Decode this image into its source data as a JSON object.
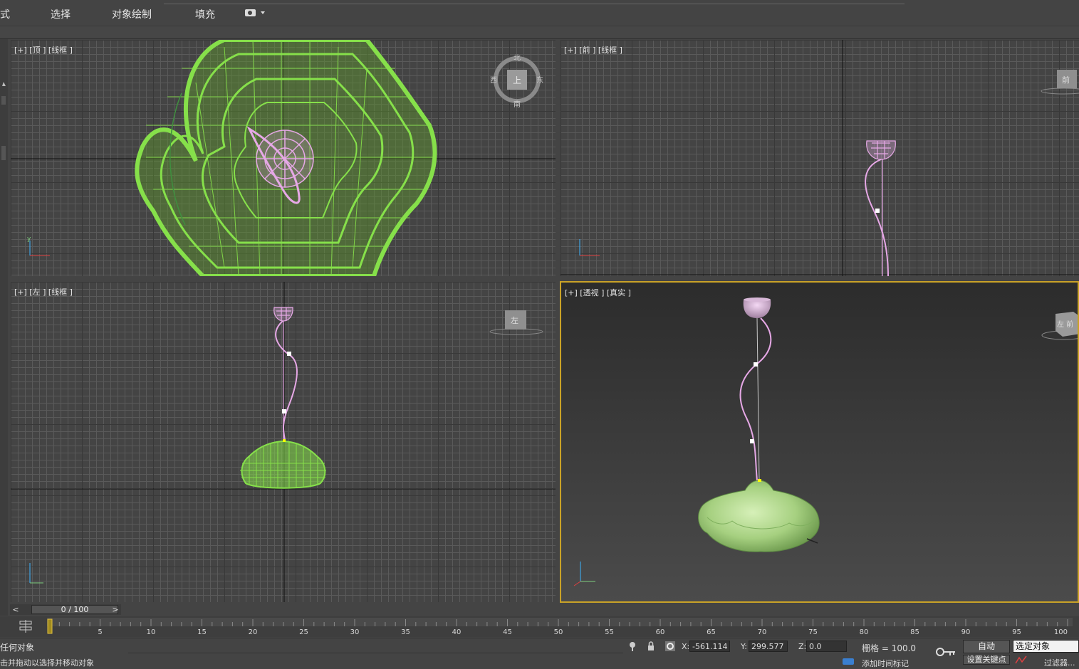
{
  "menu": {
    "items": [
      "式",
      "选择",
      "对象绘制",
      "填充"
    ],
    "dropdown_icon": "camera-dropdown-icon"
  },
  "viewports": {
    "top": {
      "label": "[+] [顶 ] [线框 ]",
      "cube": {
        "north": "北",
        "south": "南",
        "east": "东",
        "west": "西",
        "face": "上"
      }
    },
    "front": {
      "label": "[+] [前 ] [线框 ]",
      "cube_face": "前"
    },
    "left": {
      "label": "[+] [左 ] [线框 ]",
      "cube_face": "左"
    },
    "perspective": {
      "label": "[+] [透视 ] [真实 ]",
      "cube_face": "左 前"
    }
  },
  "axes": {
    "x": "x",
    "y": "y",
    "z": "z"
  },
  "time_slider": {
    "value": "0 / 100",
    "prev": "<",
    "next": ">"
  },
  "timeline": {
    "ticks": [
      5,
      10,
      15,
      20,
      25,
      30,
      35,
      40,
      45,
      50,
      55,
      60,
      65,
      70,
      75,
      80,
      85,
      90,
      95,
      100
    ],
    "current_frame": 0,
    "total_frames": 100
  },
  "status": {
    "prompt_line1": "任何对象",
    "prompt_line2": "击并拖动以选择并移动对象",
    "x_label": "X:",
    "x_value": "-561.114",
    "y_label": "Y:",
    "y_value": "299.577",
    "z_label": "Z:",
    "z_value": "0.0",
    "grid": "栅格 = 100.0",
    "add_time_tag": "添加时间标记",
    "auto_key": "自动",
    "set_key": "设置关键点",
    "selection_set": "选定对象",
    "filters": "过滤器..."
  },
  "colors": {
    "wire_green": "#86e04a",
    "cable_pink": "#e6a8e6",
    "lamp_body": "#a8d68a",
    "accent": "#c9a227"
  }
}
